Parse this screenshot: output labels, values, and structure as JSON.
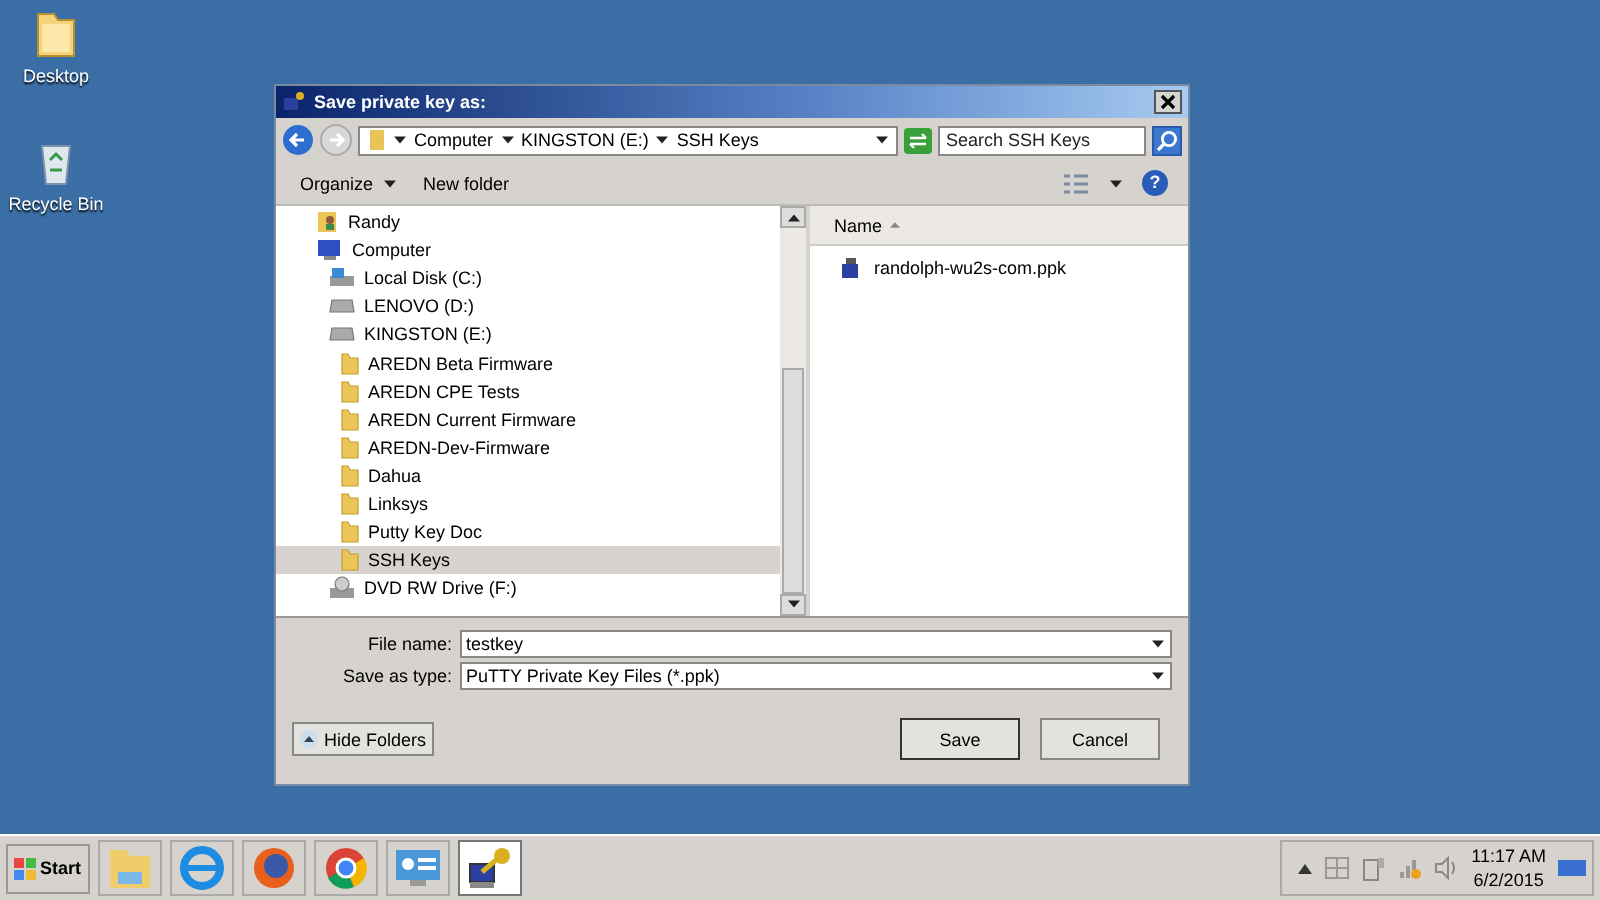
{
  "desktop_icons": [
    {
      "label": "Desktop",
      "kind": "folder"
    },
    {
      "label": "Recycle Bin",
      "kind": "bin"
    }
  ],
  "dialog": {
    "title": "Save private key as:",
    "breadcrumbs": [
      "Computer",
      "KINGSTON (E:)",
      "SSH Keys"
    ],
    "search": {
      "placeholder": "Search SSH Keys"
    },
    "toolbar": [
      "Organize",
      "New folder"
    ],
    "help": "?",
    "tree": [
      {
        "label": "Randy",
        "kind": "user",
        "selected": false
      },
      {
        "label": "Computer",
        "kind": "computer",
        "selected": false,
        "children": [
          {
            "label": "Local Disk (C:)",
            "kind": "disk",
            "selected": false
          },
          {
            "label": "LENOVO (D:)",
            "kind": "drive",
            "selected": false
          },
          {
            "label": "KINGSTON (E:)",
            "kind": "drive",
            "selected": false,
            "children": [
              {
                "label": "AREDN Beta Firmware",
                "kind": "folder",
                "selected": false
              },
              {
                "label": "AREDN CPE Tests",
                "kind": "folder",
                "selected": false
              },
              {
                "label": "AREDN Current Firmware",
                "kind": "folder",
                "selected": false
              },
              {
                "label": "AREDN-Dev-Firmware",
                "kind": "folder",
                "selected": false
              },
              {
                "label": "Dahua",
                "kind": "folder",
                "selected": false
              },
              {
                "label": "Linksys",
                "kind": "folder",
                "selected": false
              },
              {
                "label": "Putty Key Doc",
                "kind": "folder",
                "selected": false
              },
              {
                "label": "SSH Keys",
                "kind": "folder",
                "selected": true
              }
            ]
          },
          {
            "label": "DVD RW Drive (F:)",
            "kind": "dvd",
            "selected": false
          }
        ]
      }
    ],
    "column": "Name",
    "files": [
      "randolph-wu2s-com.ppk"
    ],
    "file_name": {
      "label": "File name:",
      "value": "testkey"
    },
    "save_type": {
      "label": "Save as type:",
      "value": "PuTTY Private Key Files (*.ppk)"
    },
    "hide_folders": "Hide Folders",
    "buttons": [
      "Save",
      "Cancel"
    ]
  },
  "taskbar": {
    "start": "Start",
    "apps": [
      {
        "kind": "explorer",
        "selected": false
      },
      {
        "kind": "ie",
        "selected": false
      },
      {
        "kind": "firefox",
        "selected": false
      },
      {
        "kind": "chrome",
        "selected": false
      },
      {
        "kind": "control",
        "selected": false
      },
      {
        "kind": "putty",
        "selected": true
      }
    ],
    "time": "11:17 AM",
    "date": "6/2/2015"
  }
}
